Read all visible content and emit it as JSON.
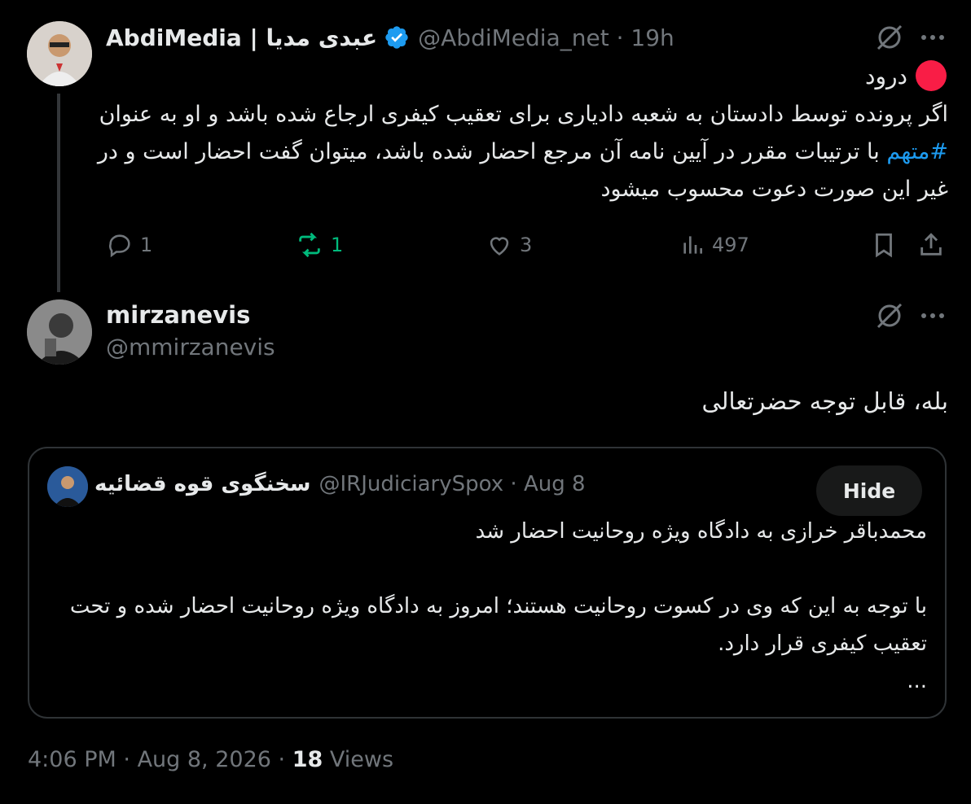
{
  "tweet1": {
    "name": "AbdiMedia | عبدی مدیا",
    "handle": "@AbdiMedia_net",
    "time": "19h",
    "greeting": "درود",
    "body_before": "اگر پرونده توسط دادستان به شعبه دادیاری برای تعقیب کیفری ارجاع شده باشد و او به عنوان ",
    "hashtag": "#متهم",
    "body_after": " با ترتیبات مقرر در آیین نامه آن مرجع احضار شده باشد، میتوان گفت احضار است و در غیر این صورت دعوت محسوب میشود",
    "replies": "1",
    "reposts": "1",
    "likes": "3",
    "views": "497"
  },
  "tweet2": {
    "name": "mirzanevis",
    "handle": "@mmirzanevis",
    "text": "بله، قابل توجه حضرتعالی"
  },
  "quote": {
    "name": "سخنگوی قوه قضائیه",
    "handle": "@IRJudiciarySpox",
    "date": "Aug 8",
    "hide_label": "Hide",
    "line1": "محمدباقر خرازی به دادگاه ویژه روحانیت احضار شد",
    "line2": "با توجه به این که وی در کسوت روحانیت هستند؛ امروز به دادگاه ویژه روحانیت احضار شده و تحت تعقیب کیفری قرار دارد.",
    "ellipsis": "..."
  },
  "footer": {
    "time": "4:06 PM",
    "date": "Aug 8, 2026",
    "views_count": "18",
    "views_label": "Views"
  },
  "icons": [
    "grok-icon",
    "more-icon",
    "reply-icon",
    "repost-icon",
    "like-icon",
    "analytics-icon",
    "bookmark-icon",
    "share-icon",
    "verified-badge-icon"
  ],
  "colors": {
    "accent": "#1d9bf0",
    "repost": "#00ba7c",
    "muted": "#71767b",
    "red": "#f91d46"
  }
}
